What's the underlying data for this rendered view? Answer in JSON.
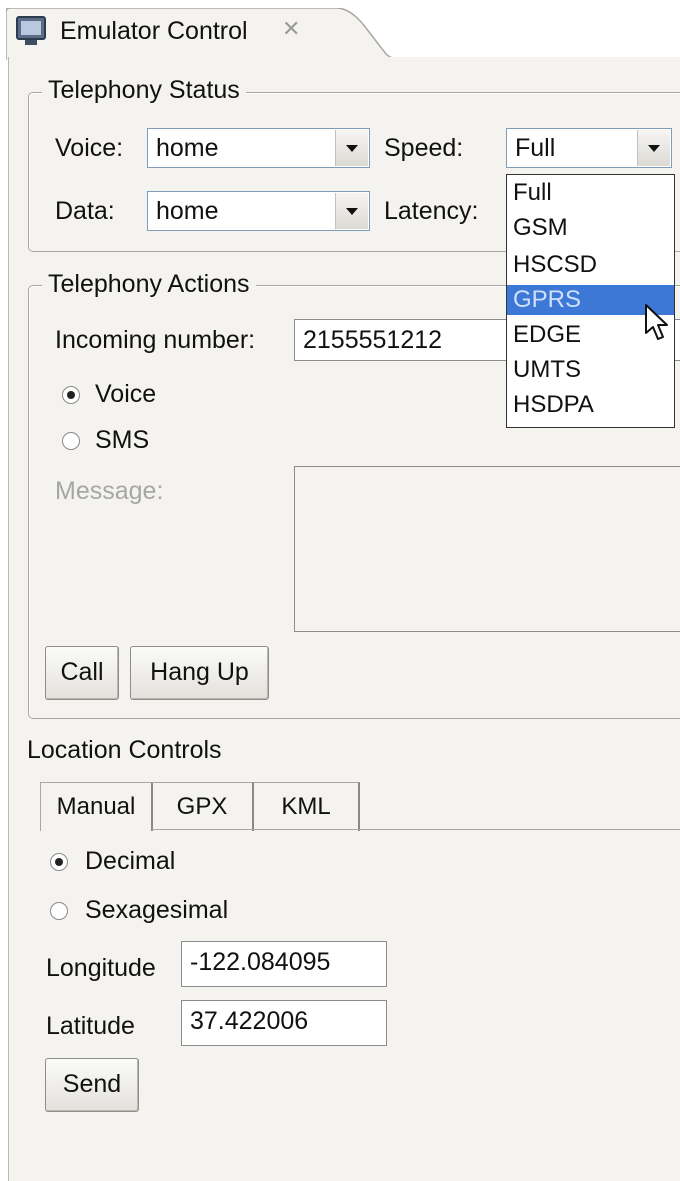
{
  "view": {
    "tab_title": "Emulator Control",
    "close_glyph": "✕",
    "icon": "emulator-monitor-icon"
  },
  "telephony_status": {
    "legend": "Telephony Status",
    "voice_label": "Voice:",
    "voice_value": "home",
    "data_label": "Data:",
    "data_value": "home",
    "speed_label": "Speed:",
    "speed_value": "Full",
    "latency_label": "Latency:",
    "speed_options": [
      "Full",
      "GSM",
      "HSCSD",
      "GPRS",
      "EDGE",
      "UMTS",
      "HSDPA"
    ],
    "highlighted_option": "GPRS"
  },
  "telephony_actions": {
    "legend": "Telephony Actions",
    "incoming_label": "Incoming number:",
    "incoming_value": "2155551212",
    "voice_radio": "Voice",
    "sms_radio": "SMS",
    "message_label": "Message:",
    "call_button": "Call",
    "hangup_button": "Hang Up"
  },
  "location_controls": {
    "title": "Location Controls",
    "tabs": [
      "Manual",
      "GPX",
      "KML"
    ],
    "decimal_radio": "Decimal",
    "sexagesimal_radio": "Sexagesimal",
    "longitude_label": "Longitude",
    "longitude_value": "-122.084095",
    "latitude_label": "Latitude",
    "latitude_value": "37.422006",
    "send_button": "Send"
  },
  "colors": {
    "highlight": "#3e78d6",
    "panel_bg": "#f4f3f0"
  }
}
